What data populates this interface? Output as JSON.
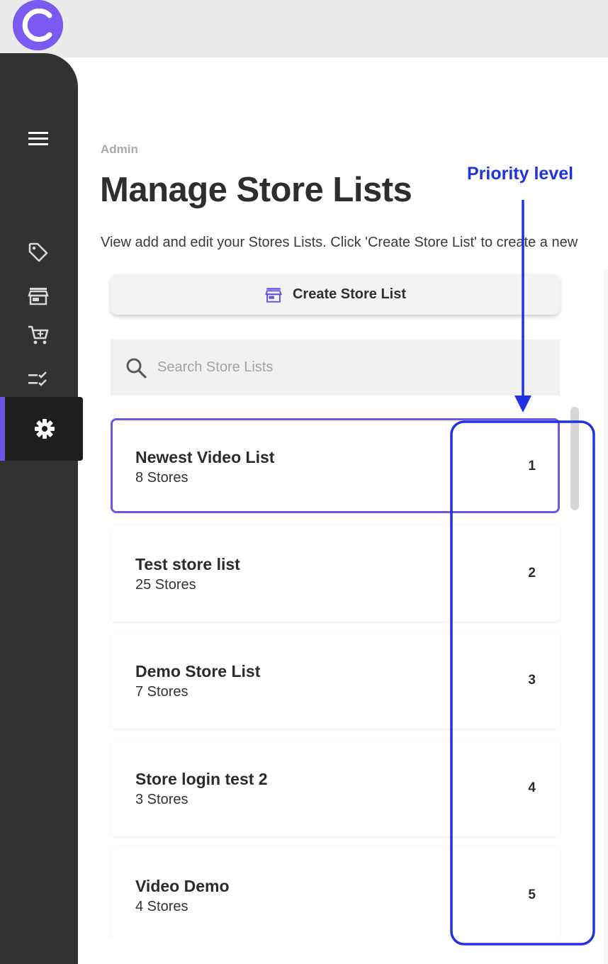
{
  "app": {
    "logo_letter": "C",
    "brand_color": "#7a5af0",
    "accent_color": "#6f55e6"
  },
  "sidebar": {
    "items": [
      {
        "icon": "menu-icon",
        "active": false
      },
      {
        "icon": "tag-icon",
        "active": false
      },
      {
        "icon": "store-icon",
        "active": false
      },
      {
        "icon": "cart-icon",
        "active": false
      },
      {
        "icon": "checklist-icon",
        "active": false
      },
      {
        "icon": "gear-icon",
        "active": true
      }
    ]
  },
  "header": {
    "breadcrumb": "Admin",
    "title": "Manage Store Lists",
    "description": "View add and edit your Stores Lists. Click 'Create Store List' to create a new"
  },
  "toolbar": {
    "create_label": "Create Store List",
    "create_icon": "store-icon"
  },
  "search": {
    "placeholder": "Search Store Lists",
    "value": ""
  },
  "store_lists": [
    {
      "name": "Newest Video List",
      "count": "8 Stores",
      "priority": "1",
      "selected": true
    },
    {
      "name": "Test store list",
      "count": "25 Stores",
      "priority": "2",
      "selected": false
    },
    {
      "name": "Demo Store List",
      "count": "7 Stores",
      "priority": "3",
      "selected": false
    },
    {
      "name": "Store login test 2",
      "count": "3 Stores",
      "priority": "4",
      "selected": false
    },
    {
      "name": "Video Demo",
      "count": "4 Stores",
      "priority": "5",
      "selected": false
    }
  ],
  "annotation": {
    "label": "Priority level",
    "color": "#1f34e0"
  }
}
